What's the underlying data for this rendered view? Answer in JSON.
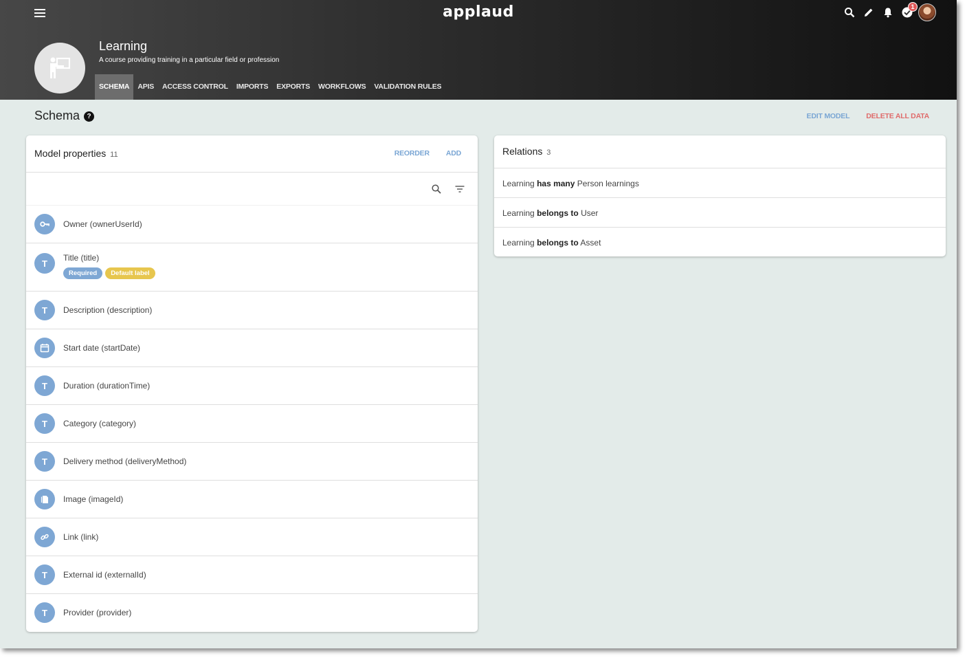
{
  "app": {
    "logo": "applaud",
    "notification_count": "1"
  },
  "model": {
    "title": "Learning",
    "subtitle": "A course providing training in a particular field or profession"
  },
  "tabs": [
    {
      "label": "SCHEMA",
      "active": true
    },
    {
      "label": "APIS"
    },
    {
      "label": "ACCESS CONTROL"
    },
    {
      "label": "IMPORTS"
    },
    {
      "label": "EXPORTS"
    },
    {
      "label": "WORKFLOWS"
    },
    {
      "label": "VALIDATION RULES"
    }
  ],
  "page": {
    "title": "Schema",
    "help_glyph": "?",
    "edit_model": "EDIT MODEL",
    "delete_all": "DELETE ALL DATA"
  },
  "properties": {
    "title": "Model properties",
    "count": "11",
    "reorder": "REORDER",
    "add": "ADD",
    "items": [
      {
        "label": "Owner (ownerUserId)",
        "icon": "key-icon",
        "glyph": ""
      },
      {
        "label": "Title (title)",
        "icon": "text-icon",
        "glyph": "T",
        "tags": [
          "Required",
          "Default label"
        ]
      },
      {
        "label": "Description (description)",
        "icon": "text-icon",
        "glyph": "T"
      },
      {
        "label": "Start date (startDate)",
        "icon": "calendar-icon",
        "glyph": ""
      },
      {
        "label": "Duration (durationTime)",
        "icon": "text-icon",
        "glyph": "T"
      },
      {
        "label": "Category (category)",
        "icon": "text-icon",
        "glyph": "T"
      },
      {
        "label": "Delivery method (deliveryMethod)",
        "icon": "text-icon",
        "glyph": "T"
      },
      {
        "label": "Image (imageId)",
        "icon": "file-icon",
        "glyph": ""
      },
      {
        "label": "Link (link)",
        "icon": "link-icon",
        "glyph": ""
      },
      {
        "label": "External id (externalId)",
        "icon": "text-icon",
        "glyph": "T"
      },
      {
        "label": "Provider (provider)",
        "icon": "text-icon",
        "glyph": "T"
      }
    ]
  },
  "relations": {
    "title": "Relations",
    "count": "3",
    "items": [
      {
        "subject": "Learning",
        "verb": "has many",
        "object": "Person learnings"
      },
      {
        "subject": "Learning",
        "verb": "belongs to",
        "object": "User"
      },
      {
        "subject": "Learning",
        "verb": "belongs to",
        "object": "Asset"
      }
    ]
  },
  "colors": {
    "accent_blue": "#7ea7d4",
    "danger_red": "#e06b6b",
    "tag_yellow": "#e7c64e",
    "page_bg": "#e3ebe9"
  }
}
